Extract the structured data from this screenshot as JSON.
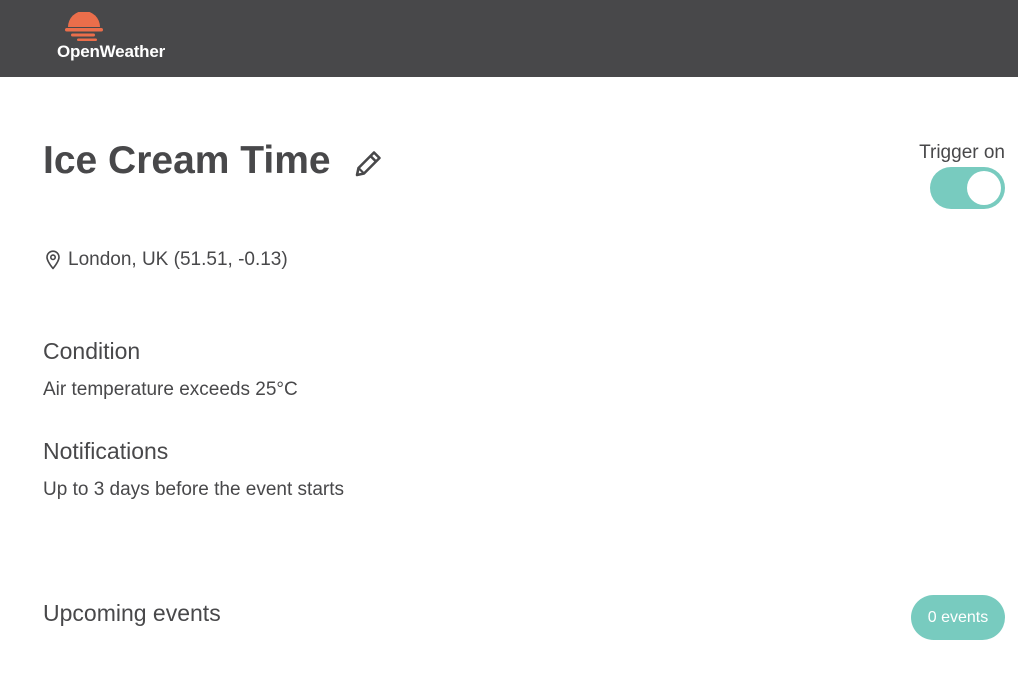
{
  "header": {
    "logo_text": "OpenWeather",
    "logo_icon": "sun-logo-icon",
    "logo_color": "#eb6e4b",
    "background": "#48484a"
  },
  "trigger": {
    "title": "Ice Cream Time",
    "edit_icon": "pencil-icon",
    "toggle_label": "Trigger on",
    "toggle_state": true,
    "toggle_color": "#78cbbf"
  },
  "location": {
    "icon": "map-pin-icon",
    "text": "London, UK (51.51, -0.13)"
  },
  "condition": {
    "heading": "Condition",
    "text": "Air temperature exceeds 25°C"
  },
  "notifications": {
    "heading": "Notifications",
    "text": "Up to 3 days before the event starts"
  },
  "upcoming": {
    "heading": "Upcoming events",
    "badge": "0 events"
  }
}
